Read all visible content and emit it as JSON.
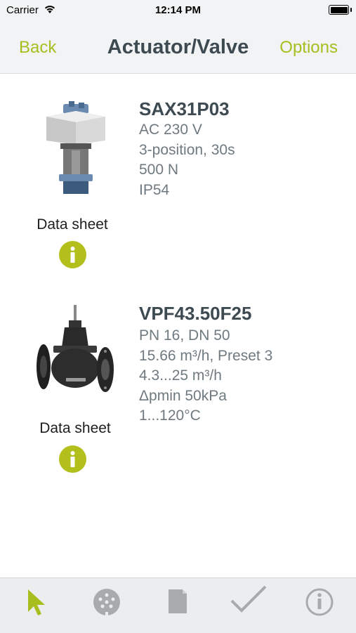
{
  "status_bar": {
    "carrier": "Carrier",
    "time": "12:14 PM"
  },
  "nav": {
    "back_label": "Back",
    "title": "Actuator/Valve",
    "options_label": "Options"
  },
  "products": [
    {
      "name": "SAX31P03",
      "specs": [
        "AC 230 V",
        "3-position, 30s",
        "500 N",
        "IP54"
      ],
      "datasheet_label": "Data sheet"
    },
    {
      "name": "VPF43.50F25",
      "specs": [
        "PN 16, DN 50",
        "15.66 m³/h, Preset 3",
        "4.3...25 m³/h",
        "Δpmin 50kPa",
        "1...120°C"
      ],
      "datasheet_label": "Data sheet"
    }
  ],
  "tabbar": {
    "items": [
      {
        "icon": "cursor-icon",
        "active": true
      },
      {
        "icon": "connector-icon",
        "active": false
      },
      {
        "icon": "document-icon",
        "active": false
      },
      {
        "icon": "checkmark-icon",
        "active": false
      },
      {
        "icon": "info-icon",
        "active": false
      }
    ]
  },
  "colors": {
    "accent": "#a7be1e",
    "info_button": "#b3c01b",
    "title": "#3d4a52",
    "spec_text": "#6f7a80",
    "inactive_icon": "#a9aaac"
  }
}
